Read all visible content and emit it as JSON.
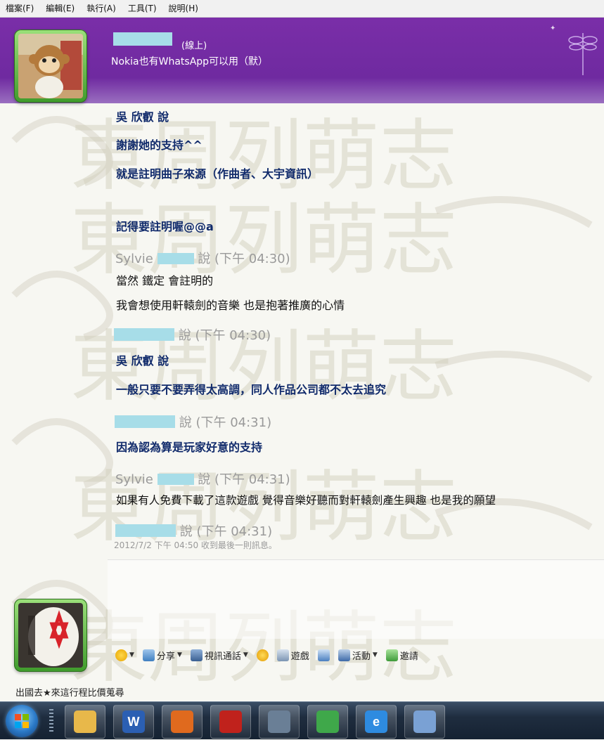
{
  "menu": [
    "檔案(F)",
    "編輯(E)",
    "執行(A)",
    "工具(T)",
    "說明(H)"
  ],
  "contact": {
    "status": "(線上)",
    "mood": "Nokia也有WhatsApp可以用（默）"
  },
  "messages": [
    {
      "type": "bold",
      "text": "吳 欣叡 說"
    },
    {
      "type": "bold",
      "text": "謝謝她的支持^^"
    },
    {
      "type": "bold",
      "text": "就是註明曲子來源（作曲者、大宇資訊）"
    },
    {
      "type": "bold",
      "text": "記得要註明喔@@a"
    },
    {
      "type": "header",
      "sender": "Sylvie",
      "text": "說 (下午 04:30)"
    },
    {
      "type": "plain",
      "text": "當然 鐵定 會註明的"
    },
    {
      "type": "plain",
      "text": "我會想使用軒轅劍的音樂 也是抱著推廣的心情"
    },
    {
      "type": "header",
      "sender": "",
      "text": "說 (下午 04:30)"
    },
    {
      "type": "bold",
      "text": "吳 欣叡 說"
    },
    {
      "type": "bold",
      "text": "一般只要不要弄得太高調，同人作品公司都不太去追究"
    },
    {
      "type": "header",
      "sender": "",
      "text": "說 (下午 04:31)"
    },
    {
      "type": "bold",
      "text": "因為認為算是玩家好意的支持"
    },
    {
      "type": "header",
      "sender": "Sylvie",
      "text": "說 (下午 04:31)"
    },
    {
      "type": "plain",
      "text": "如果有人免費下載了這款遊戲 覺得音樂好聽而對軒轅劍產生興趣 也是我的願望"
    },
    {
      "type": "header",
      "sender": "",
      "text": "說 (下午 04:31)"
    }
  ],
  "last_received": "2012/7/2 下午 04:50 收到最後一則訊息。",
  "toolbar": {
    "share": "分享",
    "video_call": "視訊通話",
    "games": "遊戲",
    "activities": "活動",
    "invite": "邀請"
  },
  "self_status": "出國去★來這行程比價蒐尋",
  "watermark_text": "東周列萌志",
  "taskbar_apps": [
    {
      "name": "explorer-icon",
      "color": "#e8b84a"
    },
    {
      "name": "word-icon",
      "color": "#2b5fb3",
      "glyph": "W"
    },
    {
      "name": "firefox-icon",
      "color": "#e06a1e"
    },
    {
      "name": "acrobat-icon",
      "color": "#c0221c"
    },
    {
      "name": "video-tool-icon",
      "color": "#6a7f96"
    },
    {
      "name": "messenger-icon",
      "color": "#3fa84a"
    },
    {
      "name": "ie-icon",
      "color": "#2e8be0",
      "glyph": "e"
    },
    {
      "name": "paint-icon",
      "color": "#7aa1d4"
    }
  ]
}
